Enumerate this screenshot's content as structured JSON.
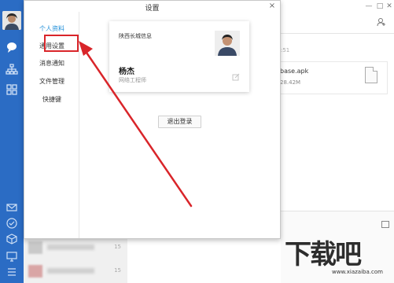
{
  "dialog": {
    "title": "设置",
    "close_label": "×"
  },
  "nav": {
    "items": [
      {
        "label": "个人资料"
      },
      {
        "label": "通用设置"
      },
      {
        "label": "消息通知"
      },
      {
        "label": "文件管理"
      },
      {
        "label": "快捷键"
      }
    ]
  },
  "profile": {
    "company": "陕西长城信息",
    "name": "杨杰",
    "title": "网络工程师"
  },
  "logout_button": "退出登录",
  "background": {
    "time_fragment": ":51",
    "file": {
      "name": "base.apk",
      "size": "28.42M"
    },
    "list_numbers": [
      "15",
      "15"
    ]
  },
  "watermark": {
    "text": "下载吧",
    "url": "www.xiazaiba.com"
  },
  "colors": {
    "rail": "#2b6cc4",
    "active_nav": "#1f8ed8",
    "annotation_red": "#d9252a"
  }
}
